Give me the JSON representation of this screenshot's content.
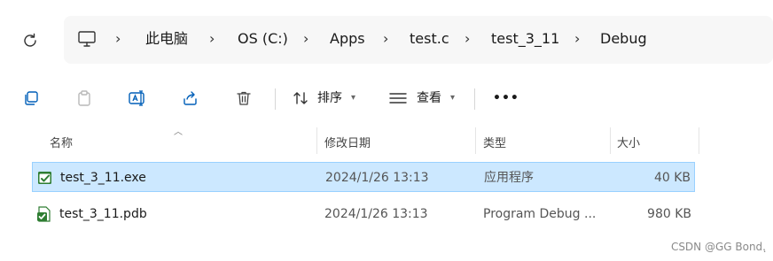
{
  "address": {
    "refresh_icon": "refresh-icon",
    "computer_icon": "monitor-icon",
    "crumbs": [
      "此电脑",
      "OS (C:)",
      "Apps",
      "test.c",
      "test_3_11",
      "Debug"
    ],
    "separator": "›"
  },
  "toolbar": {
    "sort_label": "排序",
    "view_label": "查看",
    "more_label": "•••"
  },
  "columns": {
    "name": "名称",
    "modified": "修改日期",
    "type": "类型",
    "size": "大小"
  },
  "files": [
    {
      "name": "test_3_11.exe",
      "modified": "2024/1/26 13:13",
      "type": "应用程序",
      "size": "40 KB",
      "selected": true
    },
    {
      "name": "test_3_11.pdb",
      "modified": "2024/1/26 13:13",
      "type": "Program Debug ...",
      "size": "980 KB",
      "selected": false
    }
  ],
  "watermark": "CSDN @GG Bond.ฺ",
  "colors": {
    "selection_bg": "#cce8ff",
    "selection_border": "#99d1ff",
    "accent": "#005fb8"
  }
}
